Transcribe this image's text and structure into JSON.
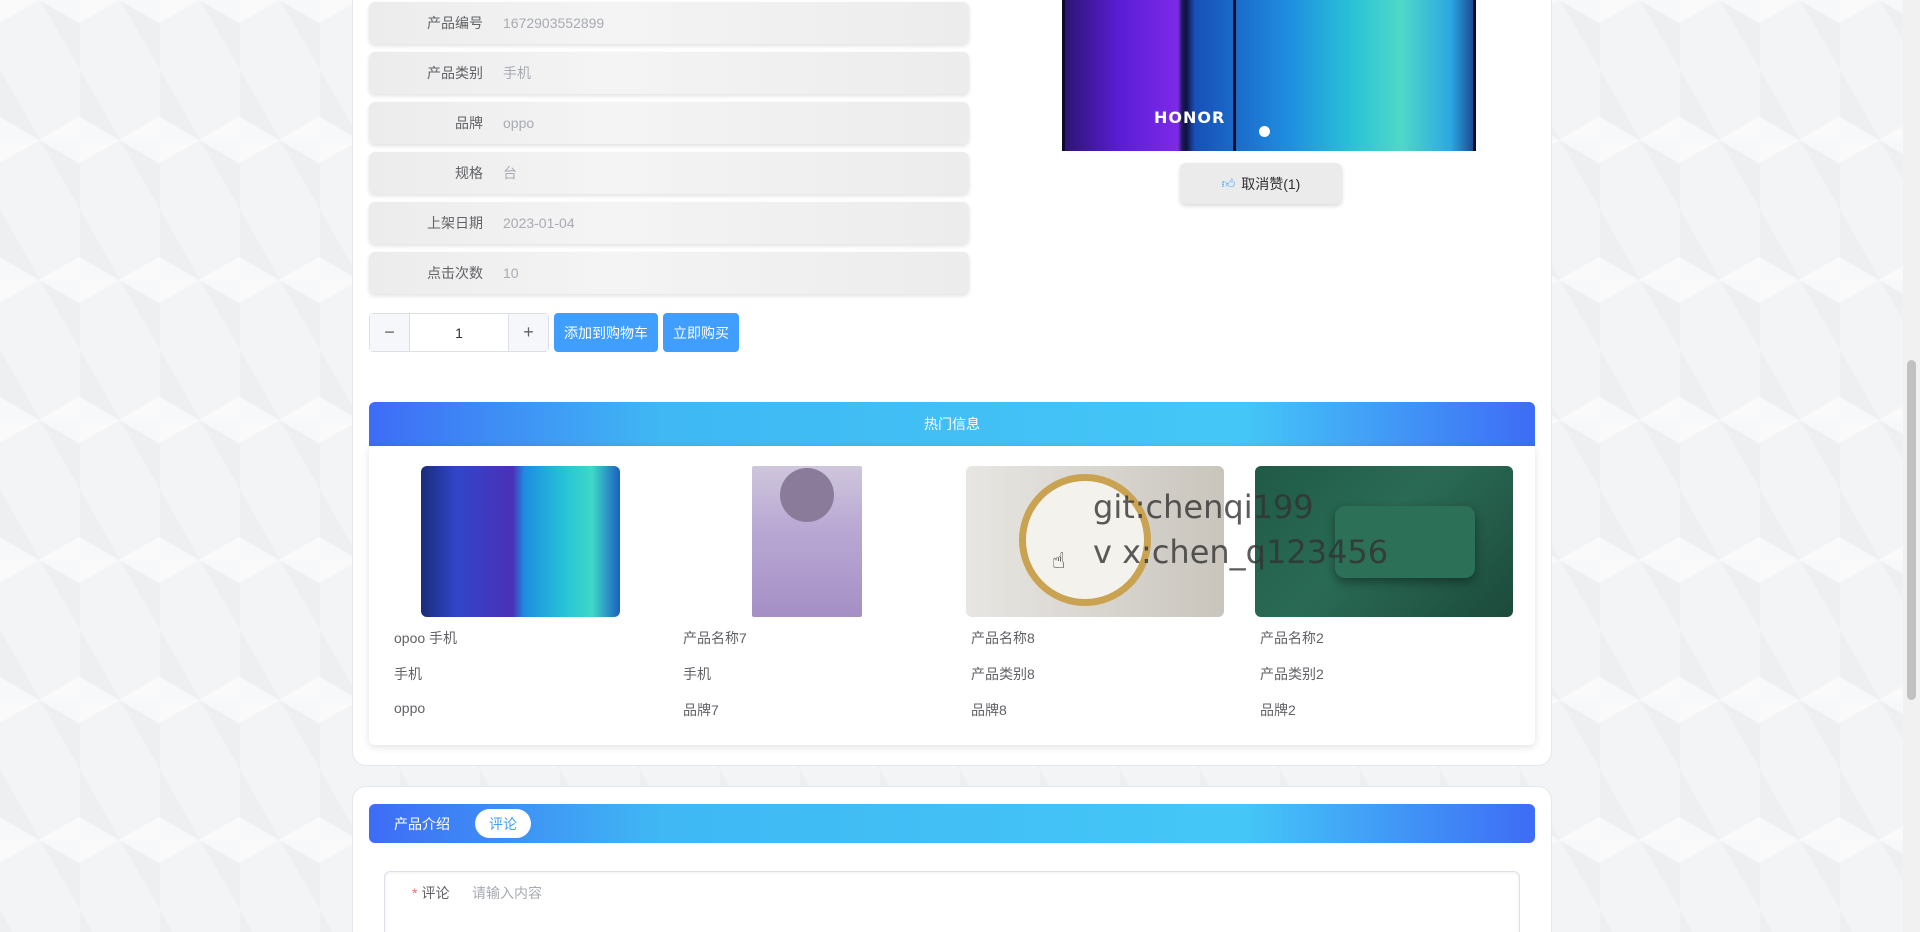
{
  "product_info": {
    "rows": [
      {
        "label": "产品编号",
        "value": "1672903552899"
      },
      {
        "label": "产品类别",
        "value": "手机"
      },
      {
        "label": "品牌",
        "value": "oppo"
      },
      {
        "label": "规格",
        "value": "台"
      },
      {
        "label": "上架日期",
        "value": "2023-01-04"
      },
      {
        "label": "点击次数",
        "value": "10"
      }
    ]
  },
  "purchase": {
    "minus_symbol": "−",
    "plus_symbol": "+",
    "quantity": "1",
    "add_to_cart": "添加到购物车",
    "buy_now": "立即购买"
  },
  "gallery": {
    "brand_text": "HONOR",
    "like_button": "取消赞(1)",
    "like_icon": "thumbs-up-icon"
  },
  "hot": {
    "title": "热门信息",
    "items": [
      {
        "name": "opoo 手机",
        "category": "手机",
        "brand": "oppo"
      },
      {
        "name": "产品名称7",
        "category": "手机",
        "brand": "品牌7"
      },
      {
        "name": "产品名称8",
        "category": "产品类别8",
        "brand": "品牌8"
      },
      {
        "name": "产品名称2",
        "category": "产品类别2",
        "brand": "品牌2"
      }
    ]
  },
  "tabs": {
    "intro": "产品介绍",
    "comments": "评论"
  },
  "comment_form": {
    "required_mark": "*",
    "label": "评论",
    "placeholder": "请输入内容"
  },
  "watermark": {
    "line1": "git:chenqi199",
    "line2": "v x:chen_q123456"
  },
  "colors": {
    "primary": "#409eff",
    "gradient_start": "#3e6cf6",
    "gradient_mid": "#44c7f7",
    "required": "#f56c6c"
  }
}
